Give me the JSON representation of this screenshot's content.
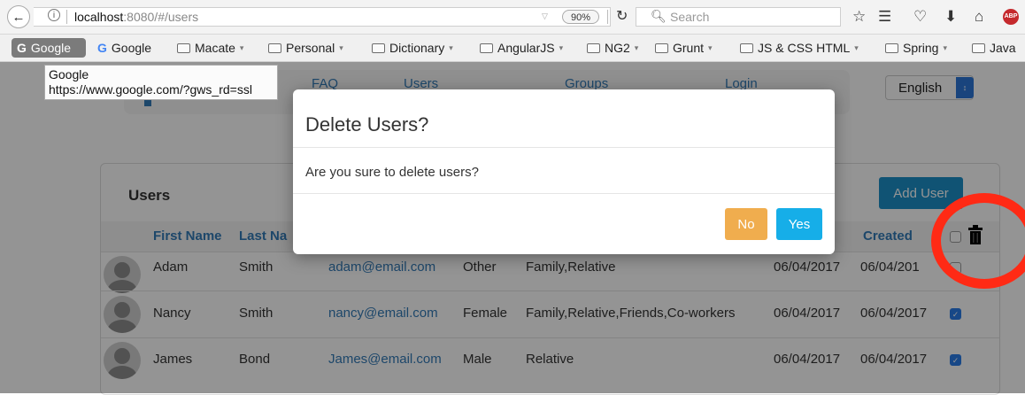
{
  "browser": {
    "url_host": "localhost",
    "url_rest": ":8080/#/users",
    "zoom": "90%",
    "search_placeholder": "Search",
    "abp_label": "ABP"
  },
  "bookmarks": [
    {
      "label": "Google",
      "active": true
    },
    {
      "label": "Google",
      "icon": "google-g-icon"
    },
    {
      "label": "Macate",
      "folder": true
    },
    {
      "label": "Personal",
      "folder": true
    },
    {
      "label": "Dictionary",
      "folder": true
    },
    {
      "label": "AngularJS",
      "folder": true
    },
    {
      "label": "NG2",
      "folder": true
    },
    {
      "label": "Grunt",
      "folder": true
    },
    {
      "label": "JS & CSS HTML",
      "folder": true
    },
    {
      "label": "Spring",
      "folder": true
    },
    {
      "label": "Java",
      "folder": true
    }
  ],
  "tooltip": {
    "line1": "Google",
    "line2": "https://www.google.com/?gws_rd=ssl"
  },
  "nav": {
    "links": [
      "FAQ",
      "Users",
      "Groups",
      "Login"
    ],
    "language": "English"
  },
  "panel": {
    "title": "Users",
    "add_button": "Add User",
    "columns": [
      "First Name",
      "Last Na",
      "Created"
    ],
    "rows": [
      {
        "first": "Adam",
        "last": "Smith",
        "email": "adam@email.com",
        "gender": "Other",
        "groups": "Family,Relative",
        "date1": "06/04/2017",
        "date2": "06/04/201",
        "checked": false
      },
      {
        "first": "Nancy",
        "last": "Smith",
        "email": "nancy@email.com",
        "gender": "Female",
        "groups": "Family,Relative,Friends,Co-workers",
        "date1": "06/04/2017",
        "date2": "06/04/2017",
        "checked": true
      },
      {
        "first": "James",
        "last": "Bond",
        "email": "James@email.com",
        "gender": "Male",
        "groups": "Relative",
        "date1": "06/04/2017",
        "date2": "06/04/2017",
        "checked": true
      }
    ]
  },
  "modal": {
    "title": "Delete Users?",
    "body": "Are you sure to delete users?",
    "no_label": "No",
    "yes_label": "Yes"
  },
  "colors": {
    "no_button": "#f0ad4e",
    "yes_button": "#16aee8",
    "annotation_ring": "#ff2a15"
  }
}
